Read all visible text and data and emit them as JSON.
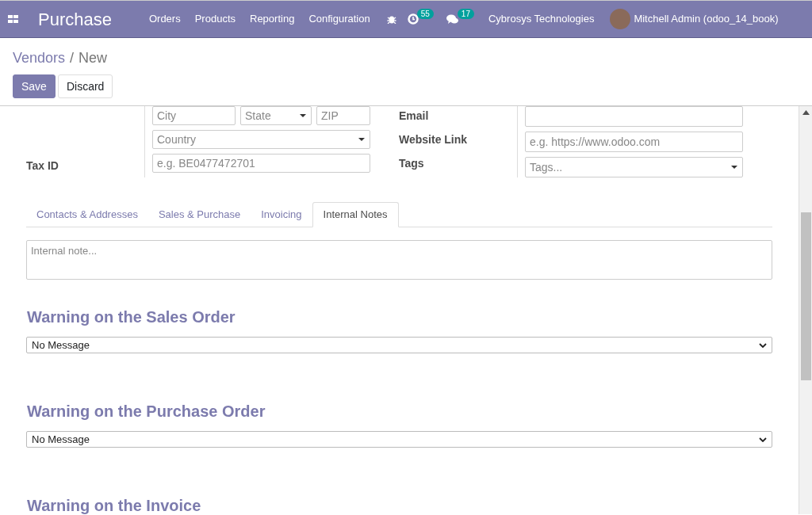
{
  "navbar": {
    "app_title": "Purchase",
    "menu": [
      "Orders",
      "Products",
      "Reporting",
      "Configuration"
    ],
    "activity_count": "55",
    "message_count": "17",
    "company": "Cybrosys Technologies",
    "user": "Mitchell Admin (odoo_14_book)"
  },
  "breadcrumb": {
    "parent": "Vendors",
    "separator": "/",
    "current": "New"
  },
  "buttons": [
    {
      "label": "Save",
      "kind": "primary"
    },
    {
      "label": "Discard",
      "kind": "secondary"
    }
  ],
  "left_rows": [
    {
      "fields": [
        {
          "placeholder": "City",
          "kind": "input"
        },
        {
          "placeholder": "State",
          "kind": "select"
        },
        {
          "placeholder": "ZIP",
          "kind": "input"
        }
      ]
    },
    {
      "fields": [
        {
          "placeholder": "Country",
          "kind": "select"
        }
      ]
    },
    {
      "label": "Tax ID",
      "fields": [
        {
          "placeholder": "e.g. BE0477472701",
          "kind": "input"
        }
      ]
    }
  ],
  "right_rows": [
    {
      "label": "Email",
      "kind": "input"
    },
    {
      "label": "Website Link",
      "kind": "input",
      "placeholder": "e.g. https://www.odoo.com"
    },
    {
      "label": "Tags",
      "kind": "select",
      "placeholder": "Tags..."
    }
  ],
  "tabs": [
    {
      "label": "Contacts & Addresses",
      "selected": false
    },
    {
      "label": "Sales & Purchase",
      "selected": false
    },
    {
      "label": "Invoicing",
      "selected": false
    },
    {
      "label": "Internal Notes",
      "selected": true
    }
  ],
  "internal_note": {
    "placeholder": "Internal note..."
  },
  "warnings": [
    {
      "title": "Warning on the Sales Order",
      "value": "No Message"
    },
    {
      "title": "Warning on the Purchase Order",
      "value": "No Message"
    },
    {
      "title": "Warning on the Invoice"
    }
  ]
}
